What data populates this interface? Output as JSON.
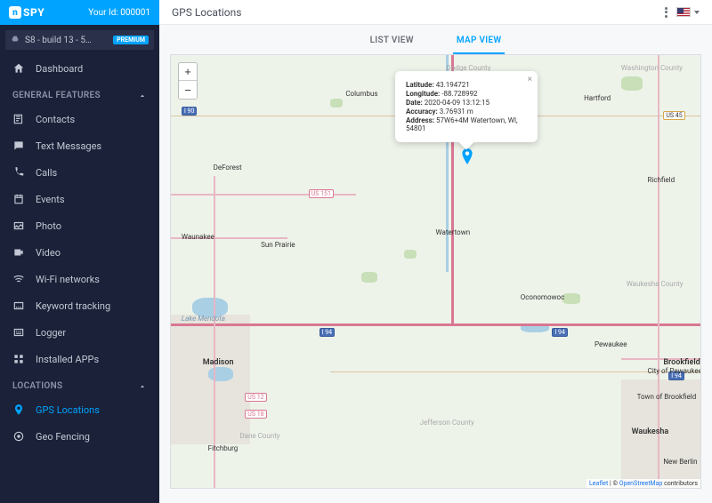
{
  "brand": {
    "mark": "n",
    "name": "SPY"
  },
  "user_id_label": "Your Id: 000001",
  "device": {
    "name": "S8 - build 13 - 5…",
    "badge": "PREMIUM"
  },
  "nav": {
    "dashboard": "Dashboard",
    "sections": {
      "general": "GENERAL FEATURES",
      "locations": "LOCATIONS"
    },
    "general_items": [
      {
        "icon": "contacts-icon",
        "label": "Contacts"
      },
      {
        "icon": "messages-icon",
        "label": "Text Messages"
      },
      {
        "icon": "calls-icon",
        "label": "Calls"
      },
      {
        "icon": "events-icon",
        "label": "Events"
      },
      {
        "icon": "photo-icon",
        "label": "Photo"
      },
      {
        "icon": "video-icon",
        "label": "Video"
      },
      {
        "icon": "wifi-icon",
        "label": "Wi-Fi networks"
      },
      {
        "icon": "keyword-icon",
        "label": "Keyword tracking"
      },
      {
        "icon": "logger-icon",
        "label": "Logger"
      },
      {
        "icon": "apps-icon",
        "label": "Installed APPs"
      }
    ],
    "location_items": [
      {
        "icon": "gps-icon",
        "label": "GPS Locations",
        "active": true
      },
      {
        "icon": "geo-icon",
        "label": "Geo Fencing"
      }
    ]
  },
  "page_title": "GPS Locations",
  "tabs": {
    "list": "LIST VIEW",
    "map": "MAP VIEW"
  },
  "popup": {
    "lat_label": "Latitude:",
    "lat": "43.194721",
    "lon_label": "Longitude:",
    "lon": "-88.728992",
    "date_label": "Date:",
    "date": "2020-04-09 13:12:15",
    "acc_label": "Accuracy:",
    "acc": "3.76931 m",
    "addr_label": "Address:",
    "addr": "57W6+4M Watertown, WI, 54801"
  },
  "zoom": {
    "in": "+",
    "out": "−"
  },
  "map_labels": {
    "columbus": "Columbus",
    "deforest": "DeForest",
    "sunprairie": "Sun Prairie",
    "waunakee": "Waunakee",
    "madison": "Madison",
    "fitchburg": "Fitchburg",
    "watertown": "Watertown",
    "oconomowoc": "Oconomowoc",
    "pewaukee": "Pewaukee",
    "brookfield": "Brookfield",
    "waukesha": "Waukesha",
    "newberlin": "New Berlin",
    "hartford": "Hartford",
    "richfield": "Richfield",
    "washingtoncty": "Washington County",
    "jeffersoncty": "Jefferson County",
    "dodgecty": "Dodge County",
    "danecty": "Dane County",
    "lakemendota": "Lake Mendota",
    "townofbrookfield": "Town of Brookfield",
    "cityofpewaukee": "City of Pewaukee",
    "waukeshacty": "Waukesha County"
  },
  "shields": {
    "i90": "I 90",
    "i94a": "I 94",
    "i94b": "I 94",
    "i94c": "I 94",
    "us151": "US 151",
    "us12": "US 12",
    "us18": "US 18",
    "us45": "US 45"
  },
  "attribution": {
    "leaflet": "Leaflet",
    "sep": " | © ",
    "osm": "OpenStreetMap",
    "tail": " contributors"
  }
}
